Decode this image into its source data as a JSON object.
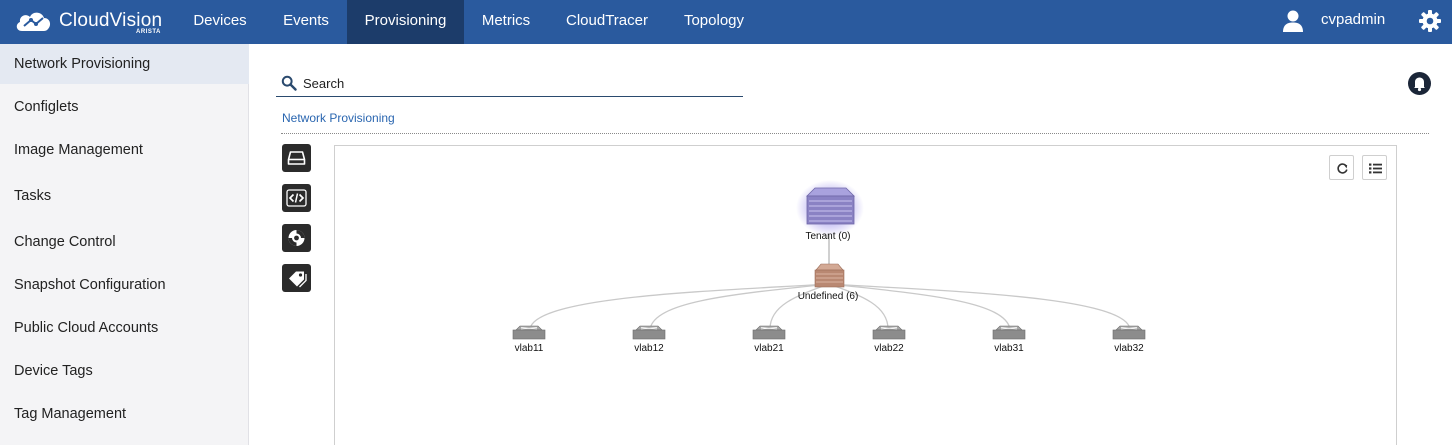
{
  "app": {
    "logo_text": "CloudVision",
    "logo_sub": "ARISTA"
  },
  "nav": {
    "items": [
      {
        "label": "Devices"
      },
      {
        "label": "Events"
      },
      {
        "label": "Provisioning",
        "active": true
      },
      {
        "label": "Metrics"
      },
      {
        "label": "CloudTracer"
      },
      {
        "label": "Topology"
      }
    ],
    "username": "cvpadmin"
  },
  "sidebar": {
    "items": [
      {
        "label": "Network Provisioning",
        "active": true
      },
      {
        "label": "Configlets"
      },
      {
        "label": "Image Management"
      },
      {
        "label": "Tasks"
      },
      {
        "label": "Change Control"
      },
      {
        "label": "Snapshot Configuration"
      },
      {
        "label": "Public Cloud Accounts"
      },
      {
        "label": "Device Tags"
      },
      {
        "label": "Tag Management"
      }
    ]
  },
  "search": {
    "placeholder": "Search",
    "value": ""
  },
  "breadcrumb": "Network Provisioning",
  "topology": {
    "root": {
      "label": "Tenant (0)"
    },
    "container": {
      "label": "Undefined (6)"
    },
    "devices": [
      {
        "label": "vlab11"
      },
      {
        "label": "vlab12"
      },
      {
        "label": "vlab21"
      },
      {
        "label": "vlab22"
      },
      {
        "label": "vlab31"
      },
      {
        "label": "vlab32"
      }
    ]
  },
  "colors": {
    "topbar": "#2a5a9e",
    "topbar_active": "#1c3c6a",
    "link": "#2a66b0",
    "tenant_node": "#8a82c4",
    "container_node": "#b98872",
    "device_node": "#8c8c8c"
  }
}
